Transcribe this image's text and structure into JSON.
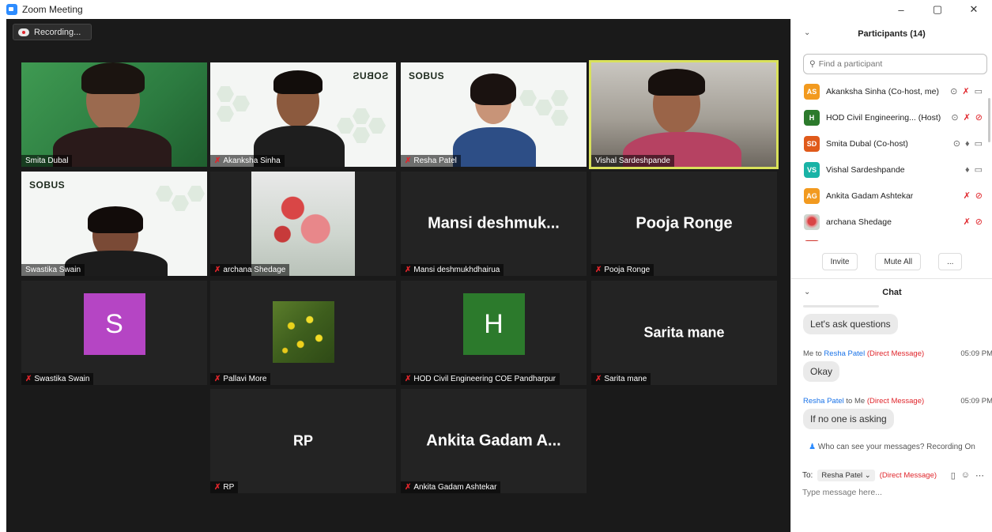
{
  "window": {
    "title": "Zoom Meeting",
    "controls": [
      "–",
      "▢",
      "✕"
    ]
  },
  "recording": {
    "label": "Recording..."
  },
  "tiles": {
    "smita": "Smita Dubal",
    "akanksha": "Akanksha Sinha",
    "resha": "Resha Patel",
    "vishal": "Vishal Sardeshpande",
    "swastika_video": "Swastika Swain",
    "archana": "archana Shedage",
    "mansi_big": "Mansi  deshmuk...",
    "mansi": "Mansi deshmukhdhairua",
    "pooja_big": "Pooja Ronge",
    "pooja": "Pooja Ronge",
    "swastika_letter": "S",
    "swastika": "Swastika Swain",
    "pallavi": "Pallavi More",
    "hod_letter": "H",
    "hod": "HOD Civil Engineering COE Pandharpur",
    "sarita_big": "Sarita mane",
    "sarita": "Sarita mane",
    "rp_big": "RP",
    "rp": "RP",
    "ankita_big": "Ankita Gadam A...",
    "ankita": "Ankita Gadam Ashtekar",
    "brand": "SOBUS",
    "brand_mirrored": "SOBUS"
  },
  "participants": {
    "title": "Participants (14)",
    "search_placeholder": "Find a participant",
    "list": [
      {
        "initials": "AS",
        "name": "Akanksha Sinha (Co-host, me)",
        "color": "#f29a1f"
      },
      {
        "initials": "H",
        "name": "HOD Civil Engineering... (Host)",
        "color": "#2c7a2c"
      },
      {
        "initials": "SD",
        "name": "Smita Dubal (Co-host)",
        "color": "#e05a1a"
      },
      {
        "initials": "VS",
        "name": "Vishal Sardeshpande",
        "color": "#19b3a6"
      },
      {
        "initials": "AG",
        "name": "Ankita Gadam Ashtekar",
        "color": "#f29a1f"
      },
      {
        "initials": "",
        "name": "archana Shedage",
        "color": "#d65a5a"
      }
    ],
    "buttons": {
      "invite": "Invite",
      "mute_all": "Mute All",
      "more": "..."
    }
  },
  "chat": {
    "title": "Chat",
    "messages": [
      {
        "text": "Let's ask questions"
      },
      {
        "from": "Me",
        "to_word": "to",
        "to": "Resha Patel",
        "dm": "(Direct Message)",
        "time": "05:09 PM",
        "text": "Okay"
      },
      {
        "from": "Resha Patel",
        "to_word": "to",
        "to": "Me",
        "dm": "(Direct Message)",
        "time": "05:09 PM",
        "text": "If no one is asking"
      }
    ],
    "visibility_note": "Who can see your messages? Recording On",
    "to_label": "To:",
    "to_value": "Resha Patel ⌄",
    "to_dm": "(Direct Message)",
    "input_placeholder": "Type message here..."
  }
}
